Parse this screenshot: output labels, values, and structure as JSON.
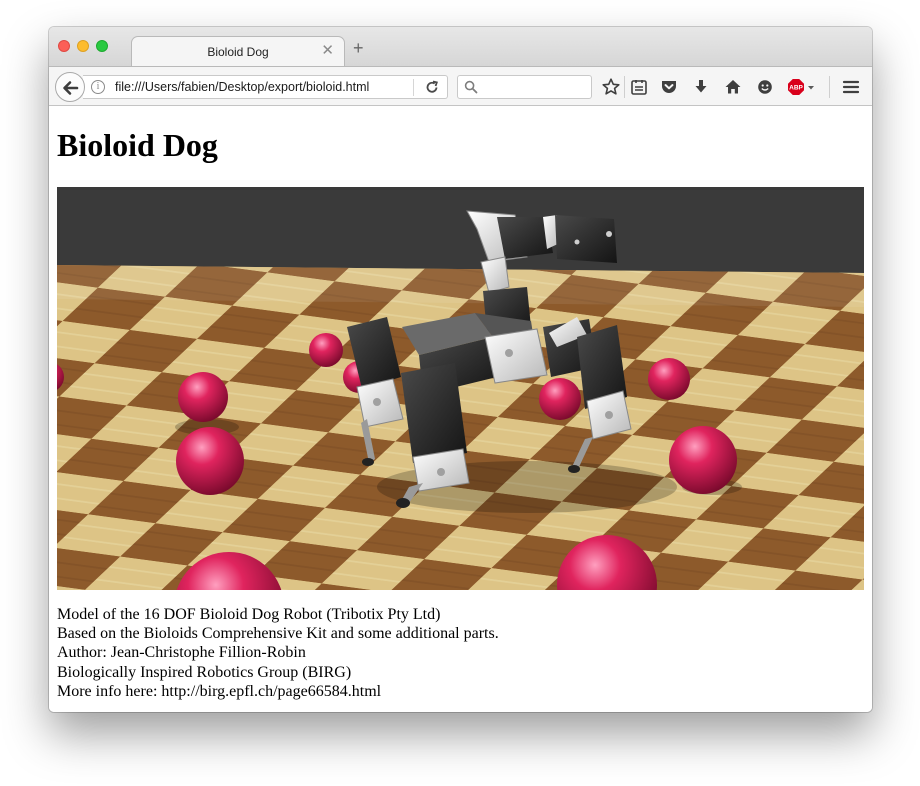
{
  "browser": {
    "tab": {
      "title": "Bioloid Dog"
    },
    "address_bar": {
      "url": "file:///Users/fabien/Desktop/export/bioloid.html"
    },
    "search_bar": {
      "placeholder": ""
    }
  },
  "page": {
    "title": "Bioloid Dog",
    "description": [
      "Model of the 16 DOF Bioloid Dog Robot (Tribotix Pty Ltd)",
      "Based on the Bioloids Comprehensive Kit and some additional parts.",
      "Author: Jean-Christophe Fillion-Robin",
      "Biologically Inspired Robotics Group (BIRG)",
      "More info here: http://birg.epfl.ch/page66584.html"
    ]
  },
  "icons": {
    "back": "back-arrow-icon",
    "info": "info-icon",
    "reload": "reload-icon",
    "search": "search-icon",
    "bookmark": "star-icon",
    "reading_list": "reading-list-icon",
    "pocket": "pocket-icon",
    "downloads": "download-arrow-icon",
    "home": "home-icon",
    "extension": "smiley-icon",
    "adblock": "adblock-plus-icon",
    "menu": "hamburger-menu-icon"
  },
  "colors": {
    "close": "#fc5f57",
    "minimize": "#fdbc2e",
    "maximize": "#29c941",
    "ball": "#e0245e",
    "sky": "#3a3a3a",
    "adblock": "#d9001b"
  }
}
